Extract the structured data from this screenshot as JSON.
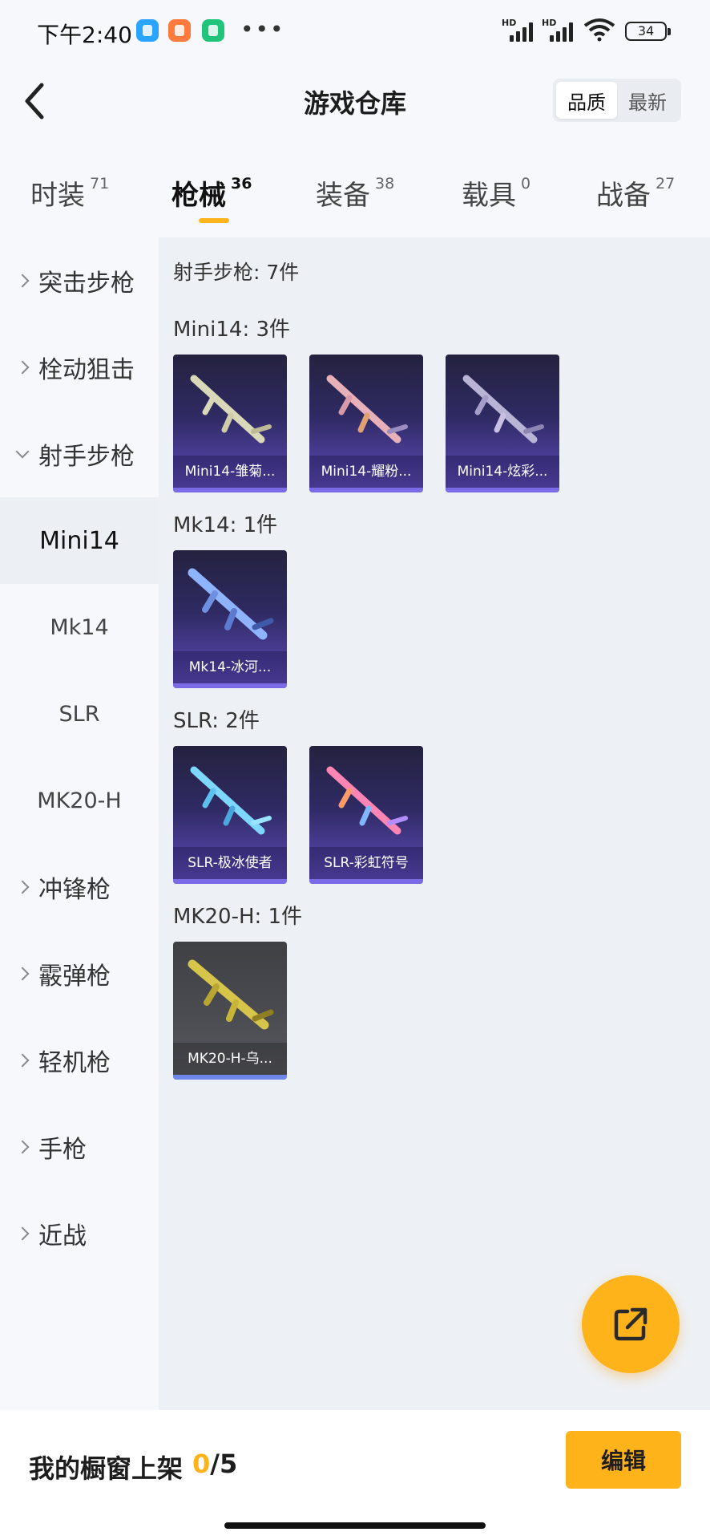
{
  "status_bar": {
    "time": "下午2:40",
    "signal_label": "HD",
    "battery": "34"
  },
  "header": {
    "title": "游戏仓库",
    "sort_options": [
      "品质",
      "最新"
    ],
    "active_sort": "品质"
  },
  "tabs": [
    {
      "label": "时装",
      "count": "71"
    },
    {
      "label": "枪械",
      "count": "36"
    },
    {
      "label": "装备",
      "count": "38"
    },
    {
      "label": "载具",
      "count": "0"
    },
    {
      "label": "战备",
      "count": "27"
    }
  ],
  "active_tab": "枪械",
  "sidebar": {
    "categories": [
      "突击步枪",
      "栓动狙击",
      "射手步枪",
      "冲锋枪",
      "霰弹枪",
      "轻机枪",
      "手枪",
      "近战"
    ],
    "expanded": "射手步枪",
    "subitems": [
      "Mini14",
      "Mk14",
      "SLR",
      "MK20-H"
    ],
    "active_subitem": "Mini14"
  },
  "content": {
    "summary": "射手步枪: 7件",
    "groups": [
      {
        "title": "Mini14: 3件",
        "items": [
          "Mini14-雏菊...",
          "Mini14-耀粉...",
          "Mini14-炫彩..."
        ]
      },
      {
        "title": "Mk14: 1件",
        "items": [
          "Mk14-冰河..."
        ]
      },
      {
        "title": "SLR: 2件",
        "items": [
          "SLR-极冰使者",
          "SLR-彩虹符号"
        ]
      },
      {
        "title": "MK20-H: 1件",
        "items": [
          "MK20-H-乌..."
        ]
      }
    ]
  },
  "icons": {
    "back": "chevron-left-icon",
    "share": "share-external-icon",
    "chevron_right": "chevron-right-icon",
    "chevron_down": "chevron-down-icon"
  },
  "bottom": {
    "showcase_label": "我的橱窗上架",
    "showcase_count": "0",
    "showcase_total": "/5",
    "edit_label": "编辑"
  },
  "colors": {
    "accent": "#ffb31a",
    "card_purple": "#4d3f9b"
  }
}
